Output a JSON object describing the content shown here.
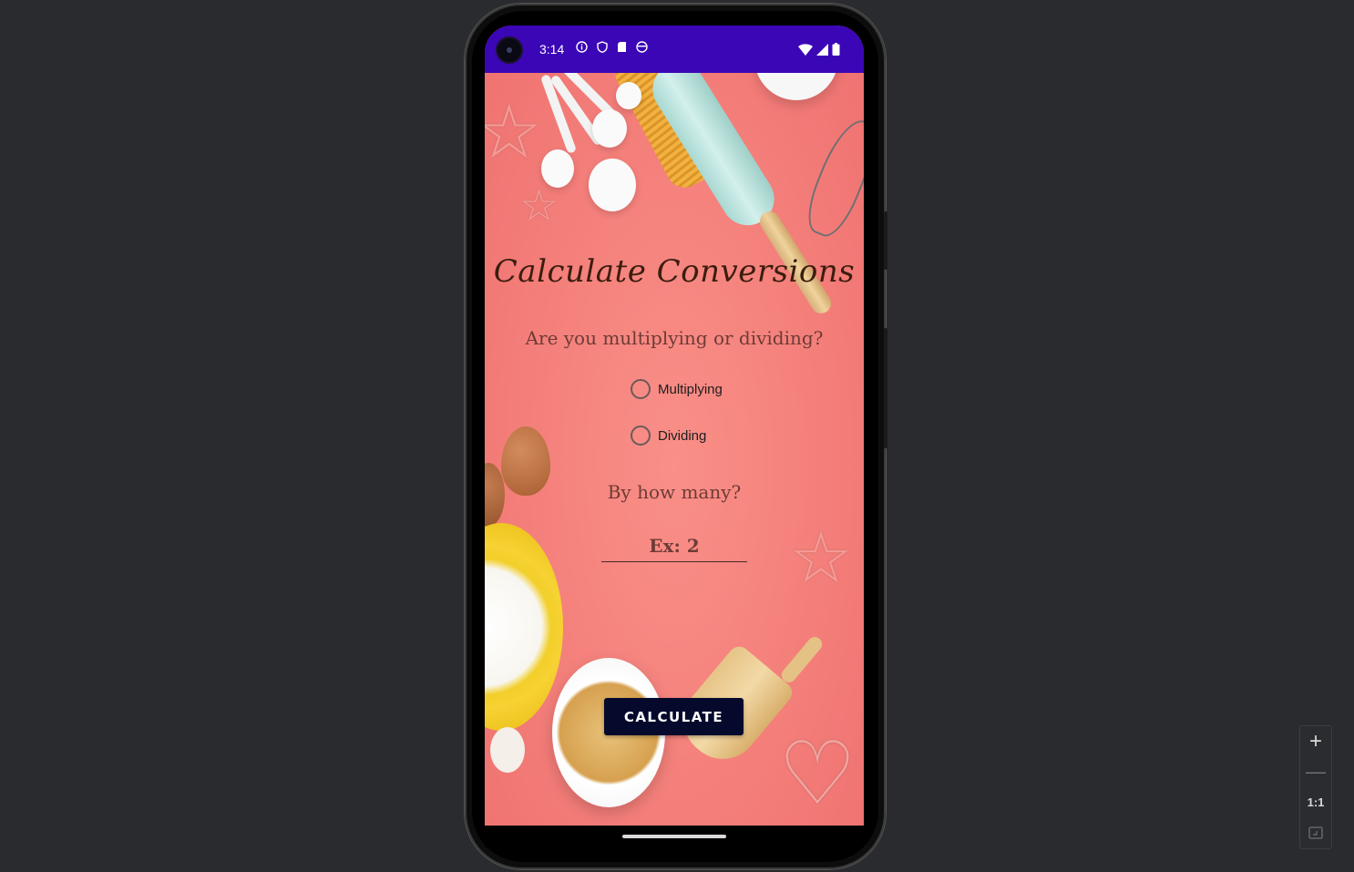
{
  "status_bar": {
    "time": "3:14"
  },
  "app": {
    "title": "Calculate Conversions",
    "question_operation": "Are you multiplying or dividing?",
    "options": [
      {
        "label": "Multiplying",
        "selected": false
      },
      {
        "label": "Dividing",
        "selected": false
      }
    ],
    "question_amount": "By how many?",
    "amount_input": {
      "value": "",
      "placeholder": "Ex: 2"
    },
    "calculate_button": "CALCULATE"
  },
  "zoom_controls": {
    "plus": "+",
    "minus": "—",
    "ratio": "1:1"
  },
  "colors": {
    "status_bar": "#3b06b6",
    "background": "#f47f7a",
    "button": "#050a2c",
    "title_text": "#3b1d0e"
  }
}
